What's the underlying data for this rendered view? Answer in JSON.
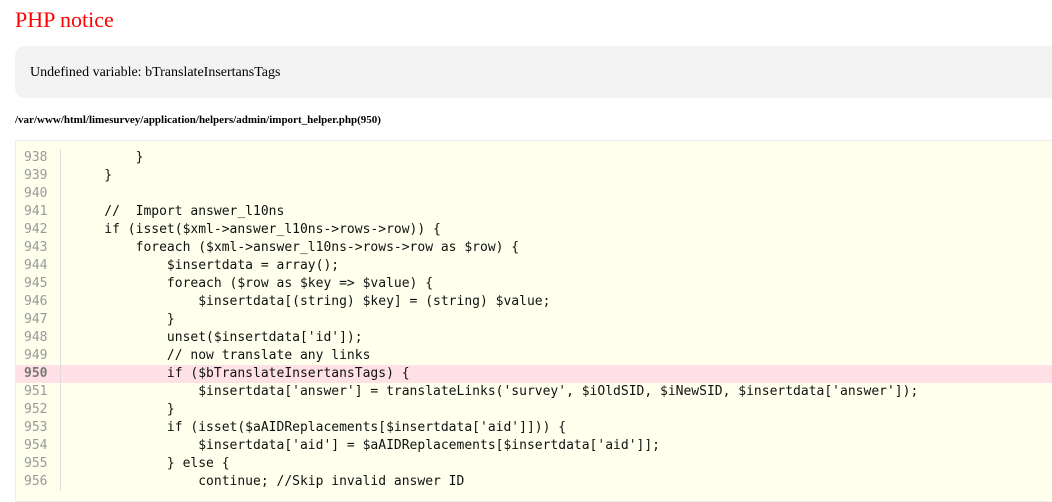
{
  "title": "PHP notice",
  "message": "Undefined variable: bTranslateInsertansTags",
  "file": "/var/www/html/limesurvey/application/helpers/admin/import_helper.php(950)",
  "error_line": "950",
  "source": [
    {
      "n": "938",
      "c": "        }"
    },
    {
      "n": "939",
      "c": "    }"
    },
    {
      "n": "940",
      "c": ""
    },
    {
      "n": "941",
      "c": "    //  Import answer_l10ns"
    },
    {
      "n": "942",
      "c": "    if (isset($xml->answer_l10ns->rows->row)) {"
    },
    {
      "n": "943",
      "c": "        foreach ($xml->answer_l10ns->rows->row as $row) {"
    },
    {
      "n": "944",
      "c": "            $insertdata = array();"
    },
    {
      "n": "945",
      "c": "            foreach ($row as $key => $value) {"
    },
    {
      "n": "946",
      "c": "                $insertdata[(string) $key] = (string) $value;"
    },
    {
      "n": "947",
      "c": "            }"
    },
    {
      "n": "948",
      "c": "            unset($insertdata['id']);"
    },
    {
      "n": "949",
      "c": "            // now translate any links"
    },
    {
      "n": "950",
      "c": "            if ($bTranslateInsertansTags) {"
    },
    {
      "n": "951",
      "c": "                $insertdata['answer'] = translateLinks('survey', $iOldSID, $iNewSID, $insertdata['answer']);"
    },
    {
      "n": "952",
      "c": "            }"
    },
    {
      "n": "953",
      "c": "            if (isset($aAIDReplacements[$insertdata['aid']])) {"
    },
    {
      "n": "954",
      "c": "                $insertdata['aid'] = $aAIDReplacements[$insertdata['aid']];"
    },
    {
      "n": "955",
      "c": "            } else {"
    },
    {
      "n": "956",
      "c": "                continue; //Skip invalid answer ID"
    }
  ]
}
